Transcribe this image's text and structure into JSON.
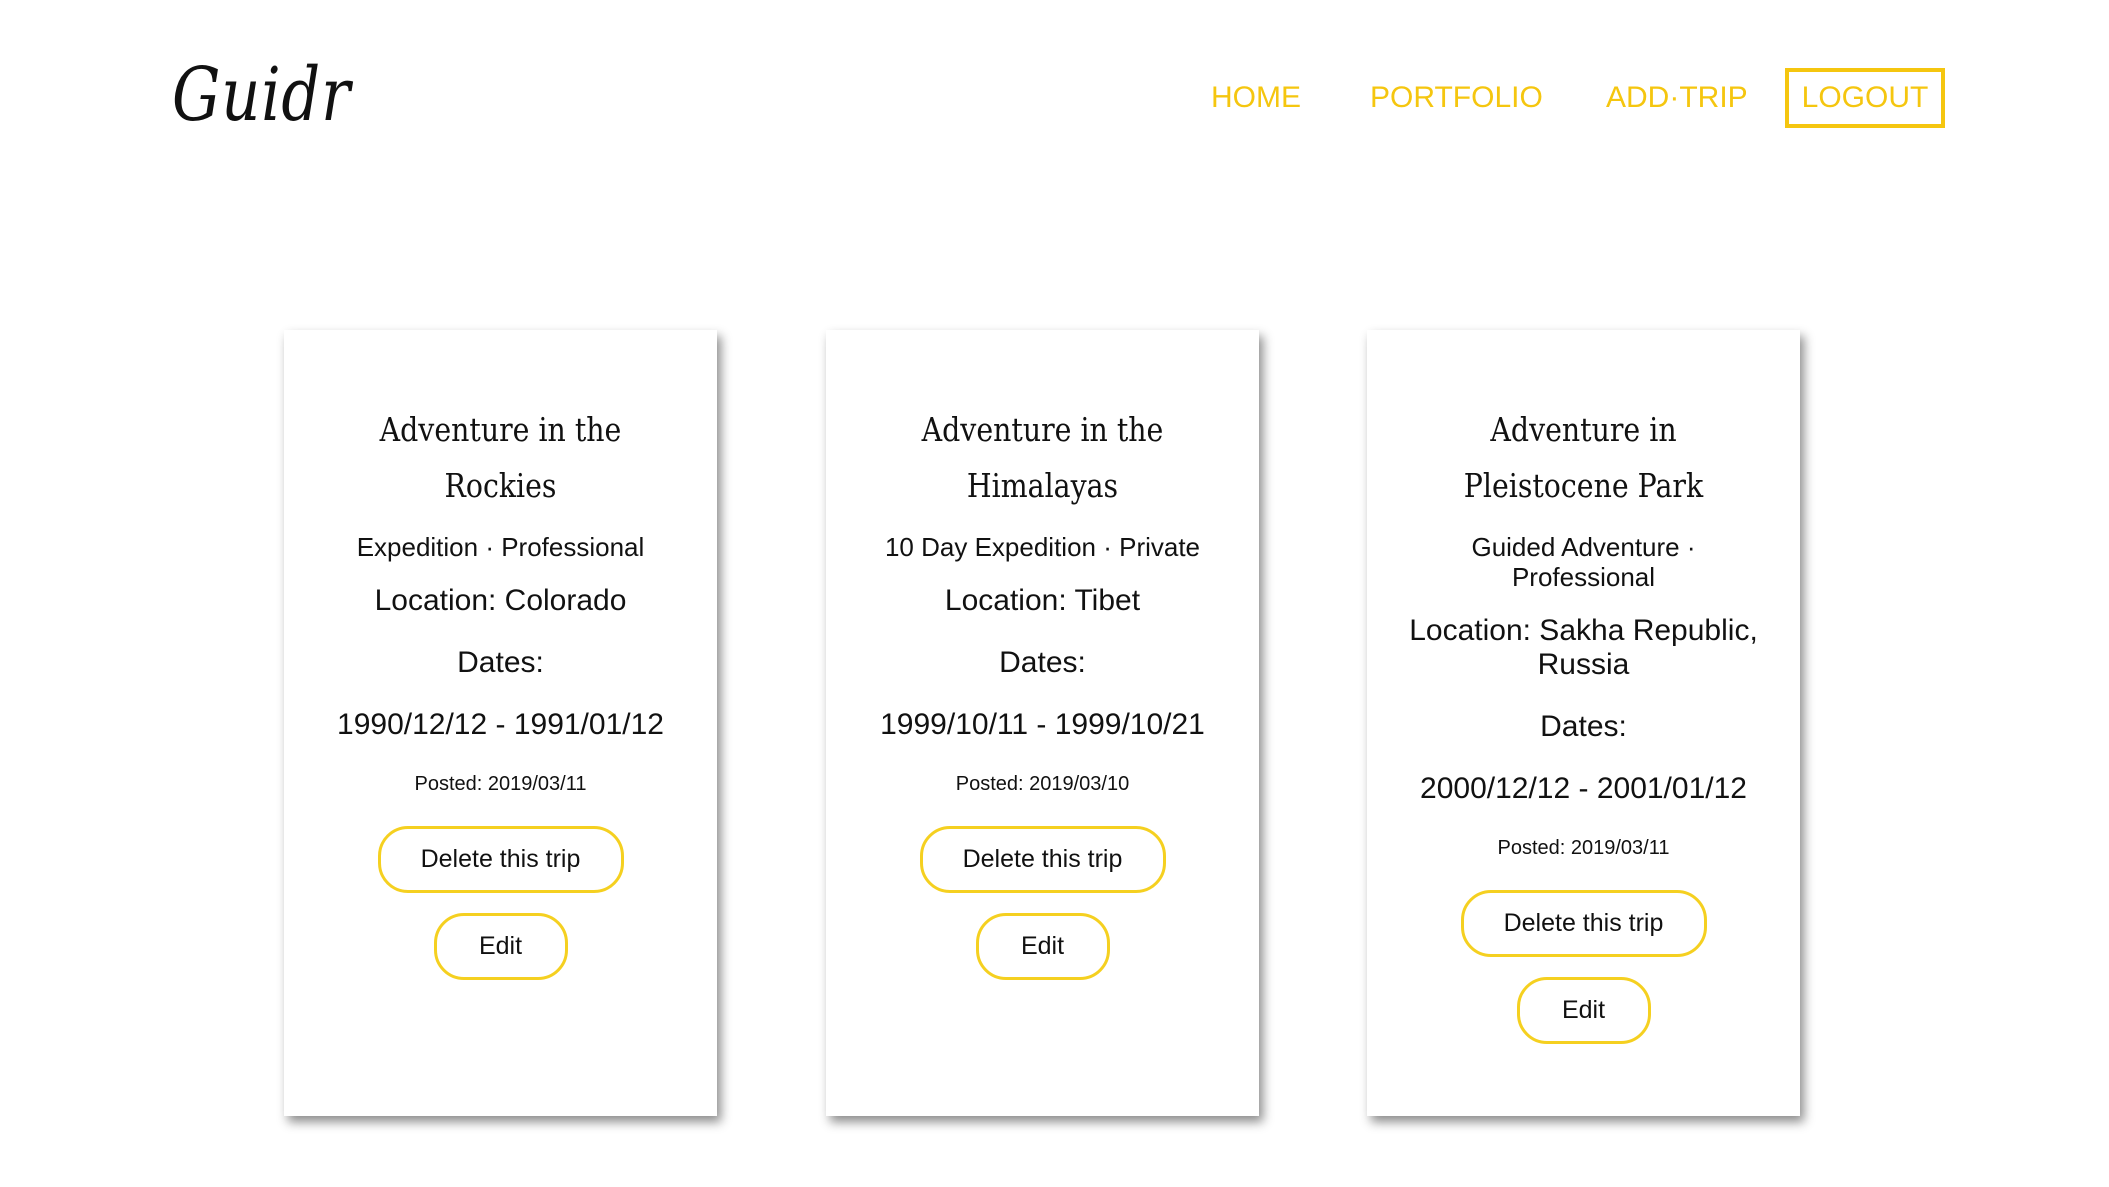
{
  "header": {
    "logo": "Guidr",
    "nav": {
      "home": "HOME",
      "portfolio": "PORTFOLIO",
      "add_trip": "ADD·TRIP",
      "logout": "LOGOUT"
    }
  },
  "colors": {
    "accent": "#f5c60f"
  },
  "trips": [
    {
      "title": "Adventure in the Rockies",
      "type": "Expedition · Professional",
      "location": "Location: Colorado",
      "dates_label": "Dates:",
      "dates": "1990/12/12 - 1991/01/12",
      "posted": "Posted: 2019/03/11",
      "delete_label": "Delete this trip",
      "edit_label": "Edit"
    },
    {
      "title": "Adventure in the Himalayas",
      "type": "10 Day Expedition · Private",
      "location": "Location: Tibet",
      "dates_label": "Dates:",
      "dates": "1999/10/11 - 1999/10/21",
      "posted": "Posted: 2019/03/10",
      "delete_label": "Delete this trip",
      "edit_label": "Edit"
    },
    {
      "title": "Adventure in Pleistocene Park",
      "type": "Guided Adventure · Professional",
      "location": "Location: Sakha Republic, Russia",
      "dates_label": "Dates:",
      "dates": "2000/12/12 - 2001/01/12",
      "posted": "Posted: 2019/03/11",
      "delete_label": "Delete this trip",
      "edit_label": "Edit"
    }
  ]
}
